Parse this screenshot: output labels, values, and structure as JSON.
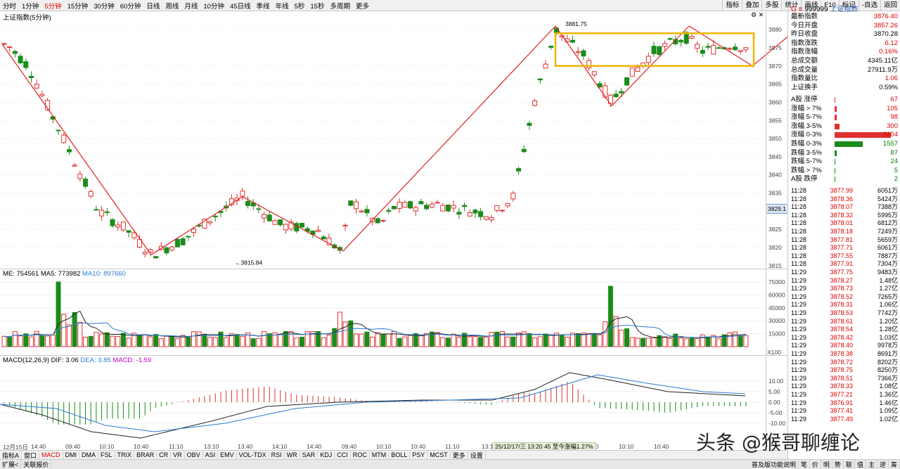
{
  "periods": [
    "分时",
    "1分钟",
    "5分钟",
    "15分钟",
    "30分钟",
    "60分钟",
    "日线",
    "周线",
    "月线",
    "10分钟",
    "45日线",
    "季线",
    "年线",
    "5秒",
    "15秒",
    "多周期",
    "更多"
  ],
  "active_period": "5分钟",
  "toolbar": [
    "指标",
    "叠加",
    "多股",
    "统计",
    "画线",
    "F10",
    "标记",
    "-自选",
    "返回"
  ],
  "chart_title": "上证指数(5分钟)",
  "stock": {
    "code": "999999",
    "name": "上证指数"
  },
  "price_axis": [
    "3880",
    "3875",
    "3870",
    "3865",
    "3860",
    "3855",
    "3850",
    "3845",
    "3840",
    "3835",
    "3830",
    "3825",
    "3820",
    "3815"
  ],
  "current_price_tag": "3829.1",
  "annot_high": "3881.75",
  "annot_low": "3815.84",
  "volume_title": {
    "prefix": "ME: 754561",
    "ma5": "MA5: 773982",
    "ma10": "MA10: 897660"
  },
  "volume_axis": [
    "75000",
    "60000",
    "45000",
    "30000",
    "15000"
  ],
  "volume_unit": "X100",
  "macd_title": {
    "name": "MACD(12,26,9)",
    "dif": "DIF: 3.06",
    "dea": "DEA: 3.85",
    "macd": "MACD: -1.59"
  },
  "macd_axis": [
    "10.00",
    "5.00",
    "0.00",
    "-5.00",
    "-10.00"
  ],
  "time_axis": [
    "12月15日",
    "14:40",
    "09:40",
    "10:10",
    "10:40",
    "11:10",
    "13:10",
    "13:40",
    "14:10",
    "14:40",
    "09:40",
    "10:10",
    "10:40",
    "11:10",
    "13:1",
    "09:40",
    "10:10",
    "10:40"
  ],
  "tooltip": "25/12/17/三 13:20 45 至今涨幅1.27%",
  "side_stats": [
    {
      "l": "最新指数",
      "v": "3876.40",
      "c": "red"
    },
    {
      "l": "今日开盘",
      "v": "3857.26",
      "c": "red"
    },
    {
      "l": "昨日收盘",
      "v": "3870.28",
      "c": ""
    },
    {
      "l": "指数涨跌",
      "v": "6.12",
      "c": "red"
    },
    {
      "l": "指数涨幅",
      "v": "0.16%",
      "c": "red"
    },
    {
      "l": "总成交额",
      "v": "4345.11亿",
      "c": ""
    },
    {
      "l": "总成交量",
      "v": "27911.9万",
      "c": ""
    },
    {
      "l": "指数量比",
      "v": "1.06",
      "c": "red"
    },
    {
      "l": "上证换手",
      "v": "0.59%",
      "c": ""
    }
  ],
  "breadth": [
    {
      "l": "A股 涨停",
      "v": "67",
      "c": "red",
      "w": 0
    },
    {
      "l": "涨幅 > 7%",
      "v": "105",
      "c": "red",
      "w": 3
    },
    {
      "l": "涨幅 5-7%",
      "v": "98",
      "c": "red",
      "w": 3
    },
    {
      "l": "涨幅 3-5%",
      "v": "300",
      "c": "red",
      "w": 7
    },
    {
      "l": "涨幅 0-3%",
      "v": "3104",
      "c": "red",
      "w": 80
    },
    {
      "l": "跌幅 0-3%",
      "v": "1557",
      "c": "green",
      "w": 40
    },
    {
      "l": "跌幅 3-5%",
      "v": "87",
      "c": "green",
      "w": 3
    },
    {
      "l": "跌幅 5-7%",
      "v": "24",
      "c": "green",
      "w": 1
    },
    {
      "l": "跌幅 > 7%",
      "v": "5",
      "c": "green",
      "w": 1
    },
    {
      "l": "A股 跌停",
      "v": "2",
      "c": "green",
      "w": 0
    }
  ],
  "ticks": [
    {
      "t": "11:28",
      "p": "3877.99",
      "q": "6051万"
    },
    {
      "t": "11:28",
      "p": "3878.36",
      "q": "5424万"
    },
    {
      "t": "11:28",
      "p": "3878.07",
      "q": "7388万"
    },
    {
      "t": "11:28",
      "p": "3878.32",
      "q": "5995万"
    },
    {
      "t": "11:28",
      "p": "3878.01",
      "q": "6812万"
    },
    {
      "t": "11:28",
      "p": "3878.18",
      "q": "7249万"
    },
    {
      "t": "11:28",
      "p": "3877.81",
      "q": "5659万"
    },
    {
      "t": "11:28",
      "p": "3877.71",
      "q": "6061万"
    },
    {
      "t": "11:28",
      "p": "3877.55",
      "q": "7887万"
    },
    {
      "t": "11:28",
      "p": "3877.91",
      "q": "7304万"
    },
    {
      "t": "11:29",
      "p": "3877.75",
      "q": "9483万"
    },
    {
      "t": "11:29",
      "p": "3878.27",
      "q": "1.48亿"
    },
    {
      "t": "11:29",
      "p": "3878.73",
      "q": "1.27亿"
    },
    {
      "t": "11:29",
      "p": "3878.52",
      "q": "7265万"
    },
    {
      "t": "11:29",
      "p": "3878.31",
      "q": "1.06亿"
    },
    {
      "t": "11:29",
      "p": "3878.53",
      "q": "7742万"
    },
    {
      "t": "11:29",
      "p": "3878.61",
      "q": "1.20亿"
    },
    {
      "t": "11:29",
      "p": "3878.54",
      "q": "1.28亿"
    },
    {
      "t": "11:29",
      "p": "3878.42",
      "q": "1.03亿"
    },
    {
      "t": "11:29",
      "p": "3878.40",
      "q": "9978万"
    },
    {
      "t": "11:29",
      "p": "3878.38",
      "q": "8691万"
    },
    {
      "t": "11:29",
      "p": "3878.72",
      "q": "8202万"
    },
    {
      "t": "11:29",
      "p": "3878.75",
      "q": "8250万"
    },
    {
      "t": "11:29",
      "p": "3878.51",
      "q": "7366万"
    },
    {
      "t": "11:29",
      "p": "3878.33",
      "q": "1.08亿"
    },
    {
      "t": "11:29",
      "p": "3877.21",
      "q": "1.36亿"
    },
    {
      "t": "11:29",
      "p": "3876.91",
      "q": "1.46亿"
    },
    {
      "t": "11:29",
      "p": "3877.41",
      "q": "1.09亿"
    },
    {
      "t": "11:29",
      "p": "3877.49",
      "q": "1.02亿"
    }
  ],
  "indicators": [
    "指标A",
    "窗口",
    "MACD",
    "DMI",
    "DMA",
    "FSL",
    "TRIX",
    "BRAR",
    "CR",
    "VR",
    "OBV",
    "ASI",
    "EMV",
    "VOL-TDX",
    "RSI",
    "WR",
    "SAR",
    "KDJ",
    "CCI",
    "ROC",
    "MTM",
    "BOLL",
    "PSY",
    "MCST",
    "更多",
    "设置"
  ],
  "active_indicator": "MACD",
  "bottom_left": [
    "扩展<",
    "关联报价"
  ],
  "bottom_right": [
    "普及版功能说明"
  ],
  "bottom_icons": [
    "笔",
    "价",
    "明",
    "势",
    "联",
    "值",
    "主",
    "逆",
    "筹"
  ],
  "watermark": "头条 @猴哥聊缠论",
  "colors": {
    "up": "#e03030",
    "down": "#1a8c1a",
    "dif": "#222222",
    "dea": "#2b7bd6",
    "highlight": "#f0b400"
  }
}
